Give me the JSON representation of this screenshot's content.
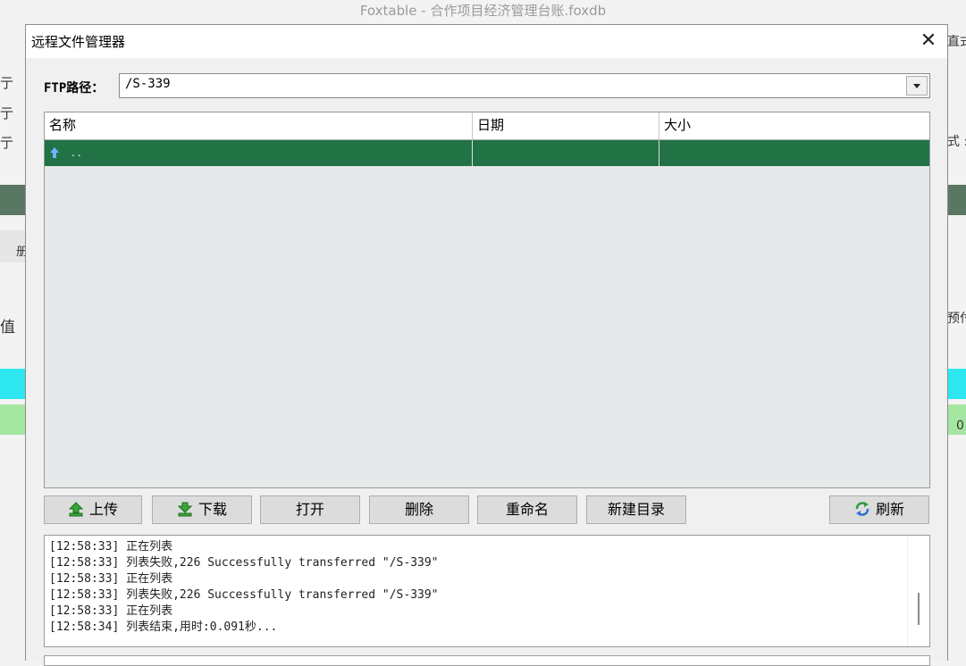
{
  "background_app": {
    "title": "Foxtable - 合作项目经济管理台账.foxdb",
    "left_fragments": [
      "亍",
      "亍",
      "亍",
      "册",
      "值"
    ],
    "right_fragments": [
      "直式",
      "式 :",
      "预付",
      "0"
    ]
  },
  "dialog": {
    "title": "远程文件管理器",
    "close_glyph": "✕",
    "ftp_path_label": "FTP路径：",
    "ftp_path_value": "/S-339",
    "columns": [
      "名称",
      "日期",
      "大小"
    ],
    "rows": [
      {
        "name": "..",
        "date": "",
        "size": "",
        "selected": true,
        "icon": "up-folder-icon"
      }
    ],
    "buttons": {
      "upload": "上传",
      "download": "下载",
      "open": "打开",
      "delete": "删除",
      "rename": "重命名",
      "new_dir": "新建目录",
      "refresh": "刷新"
    },
    "log_lines": [
      "[12:58:33] 正在列表",
      "[12:58:33] 列表失败,226 Successfully transferred \"/S-339\"",
      "[12:58:33] 正在列表",
      "[12:58:33] 列表失败,226 Successfully transferred \"/S-339\"",
      "[12:58:33] 正在列表",
      "[12:58:34] 列表结束,用时:0.091秒..."
    ]
  },
  "colors": {
    "selected_row": "#217346",
    "accent_green": "#2e9b3e"
  }
}
